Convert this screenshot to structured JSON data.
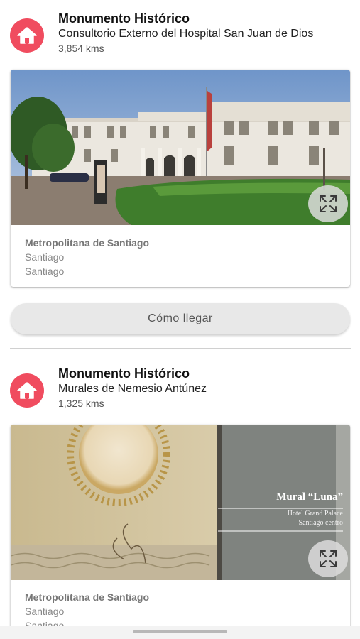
{
  "items": [
    {
      "category": "Monumento Histórico",
      "name": "Consultorio Externo del Hospital San Juan de Dios",
      "distance": "3,854 kms",
      "region": "Metropolitana de Santiago",
      "province": "Santiago",
      "commune": "Santiago",
      "icon": "home-icon",
      "expand_icon": "expand-icon"
    },
    {
      "category": "Monumento Histórico",
      "name": "Murales de Nemesio Antúnez",
      "distance": "1,325 kms",
      "region": "Metropolitana de Santiago",
      "province": "Santiago",
      "commune": "Santiago",
      "icon": "home-icon",
      "expand_icon": "expand-icon",
      "image_text": {
        "title": "Mural “Luna”",
        "line1": "Hotel Grand Palace",
        "line2": "Santiago centro"
      }
    }
  ],
  "route_button": "Cómo llegar",
  "colors": {
    "accent": "#f04c5f",
    "button_bg": "#e8e8e8"
  }
}
